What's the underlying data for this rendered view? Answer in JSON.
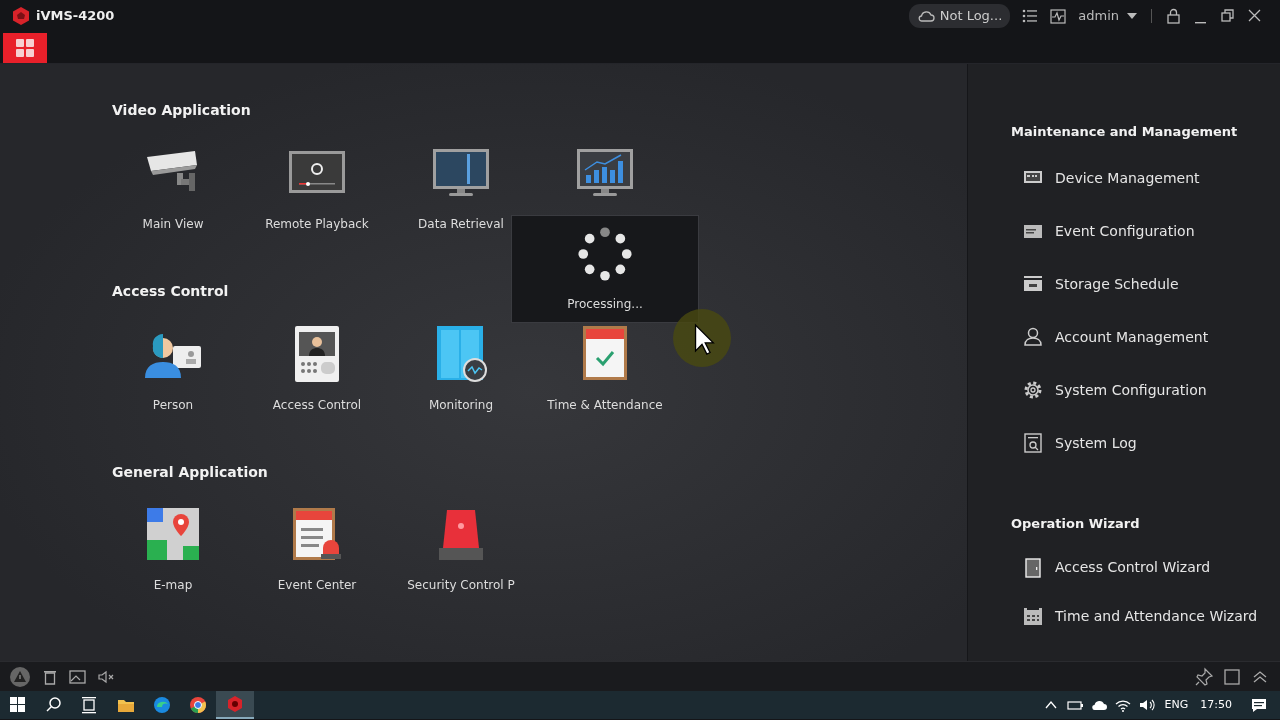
{
  "app": {
    "title": "iVMS-4200"
  },
  "header": {
    "cloud_status": "Not Log...",
    "user": "admin"
  },
  "sections": [
    {
      "title": "Video Application",
      "tiles": [
        {
          "kind": "tile",
          "label": "Main View"
        },
        {
          "kind": "tile",
          "label": "Remote Playback"
        },
        {
          "kind": "tile",
          "label": "Data Retrieval"
        },
        {
          "kind": "covered"
        }
      ]
    },
    {
      "title": "Access Control",
      "tiles": [
        {
          "kind": "tile",
          "label": "Person"
        },
        {
          "kind": "tile",
          "label": "Access Control"
        },
        {
          "kind": "tile",
          "label": "Monitoring"
        },
        {
          "kind": "tile",
          "label": "Time & Attendance"
        }
      ]
    },
    {
      "title": "General Application",
      "tiles": [
        {
          "kind": "tile",
          "label": "E-map"
        },
        {
          "kind": "tile",
          "label": "Event Center"
        },
        {
          "kind": "tile",
          "label": "Security Control P"
        }
      ]
    }
  ],
  "overlay": {
    "text": "Processing..."
  },
  "side_sections": [
    {
      "title": "Maintenance and Management",
      "items": [
        "Device Management",
        "Event Configuration",
        "Storage Schedule",
        "Account Management",
        "System Configuration",
        "System Log"
      ]
    },
    {
      "title": "Operation Wizard",
      "items": [
        "Access Control Wizard",
        "Time and Attendance Wizard"
      ]
    }
  ],
  "taskbar": {
    "language": "ENG",
    "time": "17:50"
  }
}
